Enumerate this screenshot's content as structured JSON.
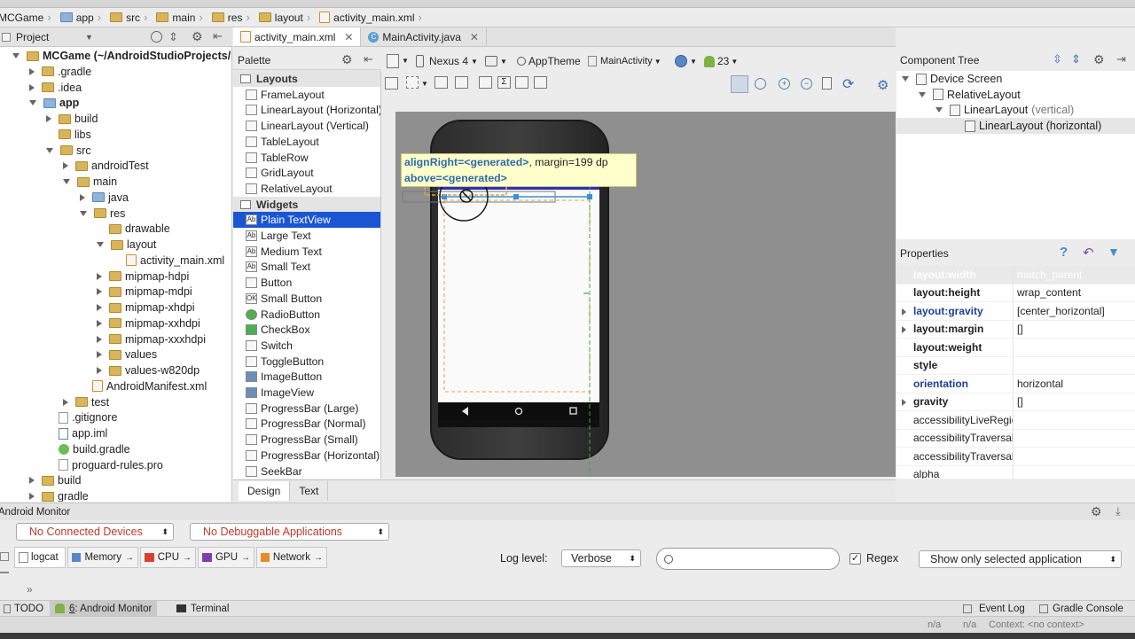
{
  "breadcrumb": [
    "MCGame",
    "app",
    "src",
    "main",
    "res",
    "layout",
    "activity_main.xml"
  ],
  "project_panel": {
    "view_label": "Project",
    "tree": [
      {
        "label": "MCGame (~/AndroidStudioProjects/MCGame)",
        "depth": 0,
        "state": "open",
        "icon": "folder-icon",
        "bold": true
      },
      {
        "label": ".gradle",
        "depth": 1,
        "state": "closed",
        "icon": "folder-icon"
      },
      {
        "label": ".idea",
        "depth": 1,
        "state": "closed",
        "icon": "folder-icon"
      },
      {
        "label": "app",
        "depth": 1,
        "state": "open",
        "icon": "module-folder-icon",
        "bold": true
      },
      {
        "label": "build",
        "depth": 2,
        "state": "closed",
        "icon": "folder-icon"
      },
      {
        "label": "libs",
        "depth": 2,
        "state": "none",
        "icon": "folder-icon"
      },
      {
        "label": "src",
        "depth": 2,
        "state": "open",
        "icon": "folder-icon"
      },
      {
        "label": "androidTest",
        "depth": 3,
        "state": "closed",
        "icon": "folder-icon"
      },
      {
        "label": "main",
        "depth": 3,
        "state": "open",
        "icon": "folder-icon"
      },
      {
        "label": "java",
        "depth": 4,
        "state": "closed",
        "icon": "source-folder-icon"
      },
      {
        "label": "res",
        "depth": 4,
        "state": "open",
        "icon": "res-folder-icon"
      },
      {
        "label": "drawable",
        "depth": 5,
        "state": "none",
        "icon": "folder-icon"
      },
      {
        "label": "layout",
        "depth": 5,
        "state": "open",
        "icon": "folder-icon"
      },
      {
        "label": "activity_main.xml",
        "depth": 6,
        "state": "none",
        "icon": "xml-file-icon"
      },
      {
        "label": "mipmap-hdpi",
        "depth": 5,
        "state": "closed",
        "icon": "folder-icon"
      },
      {
        "label": "mipmap-mdpi",
        "depth": 5,
        "state": "closed",
        "icon": "folder-icon"
      },
      {
        "label": "mipmap-xhdpi",
        "depth": 5,
        "state": "closed",
        "icon": "folder-icon"
      },
      {
        "label": "mipmap-xxhdpi",
        "depth": 5,
        "state": "closed",
        "icon": "folder-icon"
      },
      {
        "label": "mipmap-xxxhdpi",
        "depth": 5,
        "state": "closed",
        "icon": "folder-icon"
      },
      {
        "label": "values",
        "depth": 5,
        "state": "closed",
        "icon": "folder-icon"
      },
      {
        "label": "values-w820dp",
        "depth": 5,
        "state": "closed",
        "icon": "folder-icon"
      },
      {
        "label": "AndroidManifest.xml",
        "depth": 4,
        "state": "none",
        "icon": "xml-file-icon"
      },
      {
        "label": "test",
        "depth": 3,
        "state": "closed",
        "icon": "folder-icon"
      },
      {
        "label": ".gitignore",
        "depth": 2,
        "state": "none",
        "icon": "file-icon"
      },
      {
        "label": "app.iml",
        "depth": 2,
        "state": "none",
        "icon": "iml-file-icon"
      },
      {
        "label": "build.gradle",
        "depth": 2,
        "state": "none",
        "icon": "gradle-file-icon"
      },
      {
        "label": "proguard-rules.pro",
        "depth": 2,
        "state": "none",
        "icon": "file-icon"
      },
      {
        "label": "build",
        "depth": 1,
        "state": "closed",
        "icon": "folder-icon"
      },
      {
        "label": "gradle",
        "depth": 1,
        "state": "closed",
        "icon": "folder-icon"
      }
    ]
  },
  "editor_tabs": [
    {
      "label": "activity_main.xml",
      "active": true,
      "icon": "xml-file-icon"
    },
    {
      "label": "MainActivity.java",
      "active": false,
      "icon": "java-class-icon"
    }
  ],
  "palette": {
    "title": "Palette",
    "items": [
      {
        "label": "Layouts",
        "group": true
      },
      {
        "label": "FrameLayout",
        "icon": "frame-layout-icon"
      },
      {
        "label": "LinearLayout (Horizontal)",
        "icon": "linear-horizontal-icon"
      },
      {
        "label": "LinearLayout (Vertical)",
        "icon": "linear-vertical-icon"
      },
      {
        "label": "TableLayout",
        "icon": "table-layout-icon"
      },
      {
        "label": "TableRow",
        "icon": "table-row-icon"
      },
      {
        "label": "GridLayout",
        "icon": "grid-layout-icon"
      },
      {
        "label": "RelativeLayout",
        "icon": "relative-layout-icon"
      },
      {
        "label": "Widgets",
        "group": true
      },
      {
        "label": "Plain TextView",
        "icon": "textview-icon",
        "glyph": "Ab",
        "selected": true
      },
      {
        "label": "Large Text",
        "icon": "textview-icon",
        "glyph": "Ab"
      },
      {
        "label": "Medium Text",
        "icon": "textview-icon",
        "glyph": "Ab"
      },
      {
        "label": "Small Text",
        "icon": "textview-icon",
        "glyph": "Ab"
      },
      {
        "label": "Button",
        "icon": "button-icon"
      },
      {
        "label": "Small Button",
        "icon": "small-button-icon",
        "glyph": "OK"
      },
      {
        "label": "RadioButton",
        "icon": "radio-button-icon"
      },
      {
        "label": "CheckBox",
        "icon": "checkbox-icon"
      },
      {
        "label": "Switch",
        "icon": "switch-icon"
      },
      {
        "label": "ToggleButton",
        "icon": "toggle-button-icon"
      },
      {
        "label": "ImageButton",
        "icon": "image-button-icon"
      },
      {
        "label": "ImageView",
        "icon": "image-view-icon"
      },
      {
        "label": "ProgressBar (Large)",
        "icon": "progressbar-icon"
      },
      {
        "label": "ProgressBar (Normal)",
        "icon": "progressbar-icon"
      },
      {
        "label": "ProgressBar (Small)",
        "icon": "progressbar-icon"
      },
      {
        "label": "ProgressBar (Horizontal)",
        "icon": "progressbar-icon"
      },
      {
        "label": "SeekBar",
        "icon": "seekbar-icon"
      }
    ]
  },
  "design_toolbar": {
    "device": "Nexus 4",
    "theme": "AppTheme",
    "activity": "MainActivity",
    "api": "23"
  },
  "canvas": {
    "tooltip_line1_attr": "alignRight=<generated>",
    "tooltip_line1_rest": ", margin=199 dp",
    "tooltip_line2_attr": "above=<generated>"
  },
  "component_tree": {
    "title": "Component Tree",
    "nodes": [
      {
        "label": "Device Screen",
        "extra": "",
        "depth": 0,
        "state": "open",
        "icon": "device-screen-icon"
      },
      {
        "label": "RelativeLayout",
        "extra": "",
        "depth": 1,
        "state": "open",
        "icon": "relative-layout-icon"
      },
      {
        "label": "LinearLayout",
        "extra": "(vertical)",
        "depth": 2,
        "state": "open",
        "icon": "linear-vertical-icon"
      },
      {
        "label": "LinearLayout (horizontal)",
        "extra": "",
        "depth": 3,
        "state": "none",
        "icon": "linear-horizontal-icon",
        "selected": true
      }
    ]
  },
  "properties": {
    "title": "Properties",
    "rows": [
      {
        "key": "layout:width",
        "value": "match_parent",
        "style": "muted"
      },
      {
        "key": "layout:height",
        "value": "wrap_content",
        "style": "bold"
      },
      {
        "key": "layout:gravity",
        "value": "[center_horizontal]",
        "style": "blue",
        "expand": true
      },
      {
        "key": "layout:margin",
        "value": "[]",
        "style": "bold",
        "expand": true
      },
      {
        "key": "layout:weight",
        "value": "",
        "style": "bold"
      },
      {
        "key": "style",
        "value": "",
        "style": "bold"
      },
      {
        "key": "orientation",
        "value": "horizontal",
        "style": "blue"
      },
      {
        "key": "gravity",
        "value": "[]",
        "style": "bold",
        "expand": true
      },
      {
        "key": "accessibilityLiveRegion",
        "value": "",
        "style": "plain"
      },
      {
        "key": "accessibilityTraversalAfter",
        "value": "",
        "style": "plain"
      },
      {
        "key": "accessibilityTraversalBefore",
        "value": "",
        "style": "plain"
      },
      {
        "key": "alpha",
        "value": "",
        "style": "plain"
      }
    ]
  },
  "bottom_editor_tabs": [
    "Design",
    "Text"
  ],
  "android_monitor": {
    "title": "Android Monitor",
    "devices_combo": "No Connected Devices",
    "apps_combo": "No Debuggable Applications",
    "tabs": [
      "logcat",
      "Memory",
      "CPU",
      "GPU",
      "Network"
    ],
    "log_level_label": "Log level:",
    "log_level_value": "Verbose",
    "search_placeholder": "",
    "regex_label": "Regex",
    "regex_checked": true,
    "filter_value": "Show only selected application",
    "collapse_glyph": "»"
  },
  "status_bar": {
    "todo": "TODO",
    "monitor_number": "6",
    "monitor_label": ": Android Monitor",
    "terminal": "Terminal",
    "event_log": "Event Log",
    "gradle_console": "Gradle Console"
  },
  "bottom_bar": {
    "na1": "n/a",
    "na2": "n/a",
    "context": "Context: <no context>"
  },
  "colors": {
    "selection_blue": "#1a56d4",
    "property_blue": "#1c3f95",
    "tooltip_bg": "#ffffcc",
    "tooltip_text": "#2e6aa8",
    "guide_green": "#3cab3c",
    "guide_orange": "#e8a33a"
  }
}
